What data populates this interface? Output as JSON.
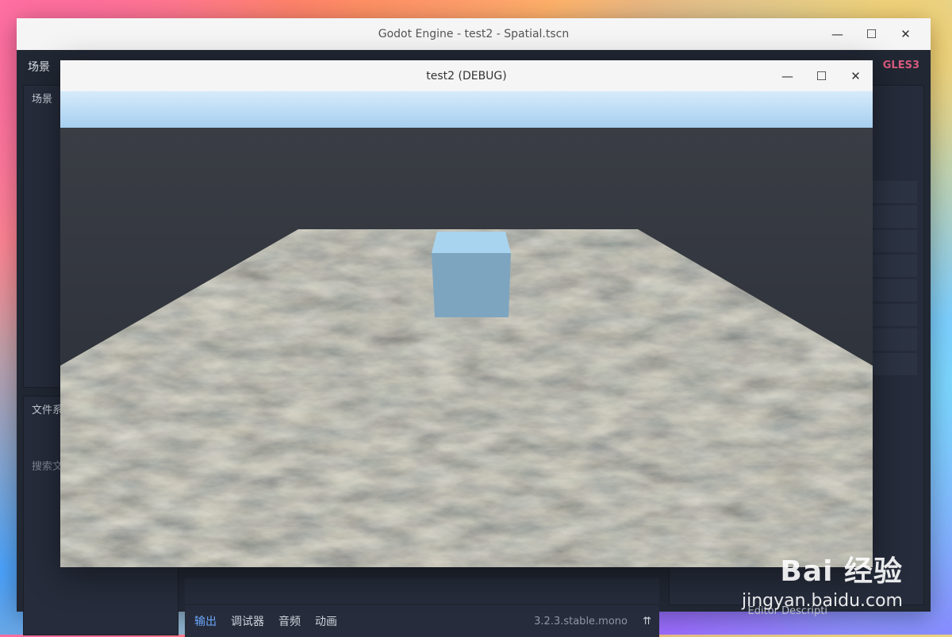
{
  "main_window": {
    "title": "Godot Engine - test2 - Spatial.tscn",
    "controls": {
      "minimize": "—",
      "maximize": "☐",
      "close": "✕"
    }
  },
  "editor": {
    "menu_first": "场景",
    "renderer": "GLES3",
    "scene_dock_label": "场景",
    "filesystem_dock_label": "文件系",
    "filesystem_search_placeholder": "搜索文",
    "bottom_tabs": [
      "输出",
      "调试器",
      "音频",
      "动画"
    ],
    "version": "3.2.3.stable.mono",
    "editor_description_label": "Editor Descripti"
  },
  "debug_window": {
    "title": "test2 (DEBUG)",
    "controls": {
      "minimize": "—",
      "maximize": "☐",
      "close": "✕"
    }
  },
  "watermark": {
    "logo": "Bai 经验",
    "url": "jingyan.baidu.com"
  },
  "colors": {
    "sky_top": "#cfe7fb",
    "sky_bottom": "#a9d1f2",
    "horizon_dark": "#2b303b",
    "cube_front": "#7ea5bf",
    "cube_top": "#a8d4ef",
    "renderer_accent": "#d85b7f",
    "active_tab": "#6aa8ff"
  }
}
